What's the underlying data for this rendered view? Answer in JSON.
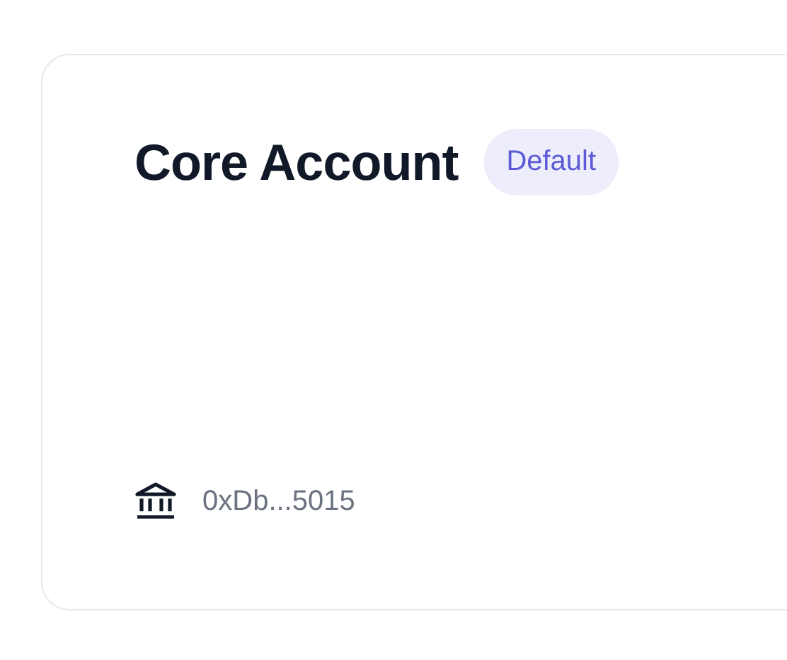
{
  "account": {
    "name": "Core Account",
    "badge": "Default",
    "address": "0xDb...5015"
  }
}
